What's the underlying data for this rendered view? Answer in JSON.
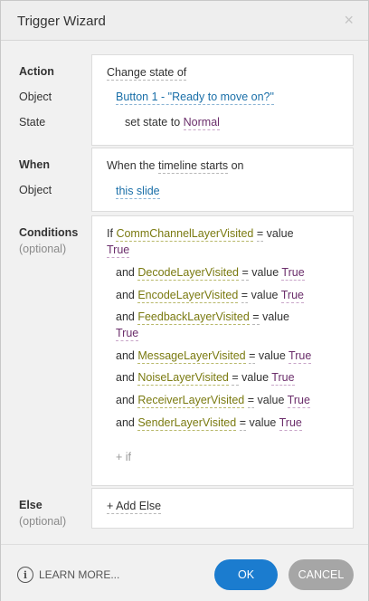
{
  "window": {
    "title": "Trigger Wizard",
    "close_glyph": "×"
  },
  "labels": {
    "action": "Action",
    "object": "Object",
    "state": "State",
    "when": "When",
    "when_object": "Object",
    "conditions": "Conditions",
    "conditions_sub": "(optional)",
    "else": "Else",
    "else_sub": "(optional)"
  },
  "action": {
    "verb": "Change state of",
    "object": "Button 1 - \"Ready to move on?\"",
    "state_prefix": "set state to",
    "state_value": "Normal"
  },
  "when": {
    "prefix": "When the",
    "event": "timeline starts",
    "on": "on",
    "object": "this slide"
  },
  "conditions": {
    "first": {
      "keyword": "If",
      "variable": "CommChannelLayerVisited",
      "op": "=",
      "value_label": "value",
      "value": "True"
    },
    "items": [
      {
        "keyword": "and",
        "variable": "DecodeLayerVisited",
        "op": "=",
        "value_label": "value",
        "value": "True"
      },
      {
        "keyword": "and",
        "variable": "EncodeLayerVisited",
        "op": "=",
        "value_label": "value",
        "value": "True"
      },
      {
        "keyword": "and",
        "variable": "FeedbackLayerVisited",
        "op": "=",
        "value_label": "value",
        "value": "True"
      },
      {
        "keyword": "and",
        "variable": "MessageLayerVisited",
        "op": "=",
        "value_label": "value",
        "value": "True"
      },
      {
        "keyword": "and",
        "variable": "NoiseLayerVisited",
        "op": "=",
        "value_label": "value",
        "value": "True"
      },
      {
        "keyword": "and",
        "variable": "ReceiverLayerVisited",
        "op": "=",
        "value_label": "value",
        "value": "True"
      },
      {
        "keyword": "and",
        "variable": "SenderLayerVisited",
        "op": "=",
        "value_label": "value",
        "value": "True"
      }
    ],
    "add_if": "+ if"
  },
  "else_section": {
    "add_else": "+ Add Else"
  },
  "footer": {
    "info_glyph": "i",
    "learn_more": "LEARN MORE...",
    "ok": "OK",
    "cancel": "CANCEL"
  },
  "colors": {
    "ok_button": "#1b7ccf",
    "cancel_button": "#a6a6a6"
  }
}
